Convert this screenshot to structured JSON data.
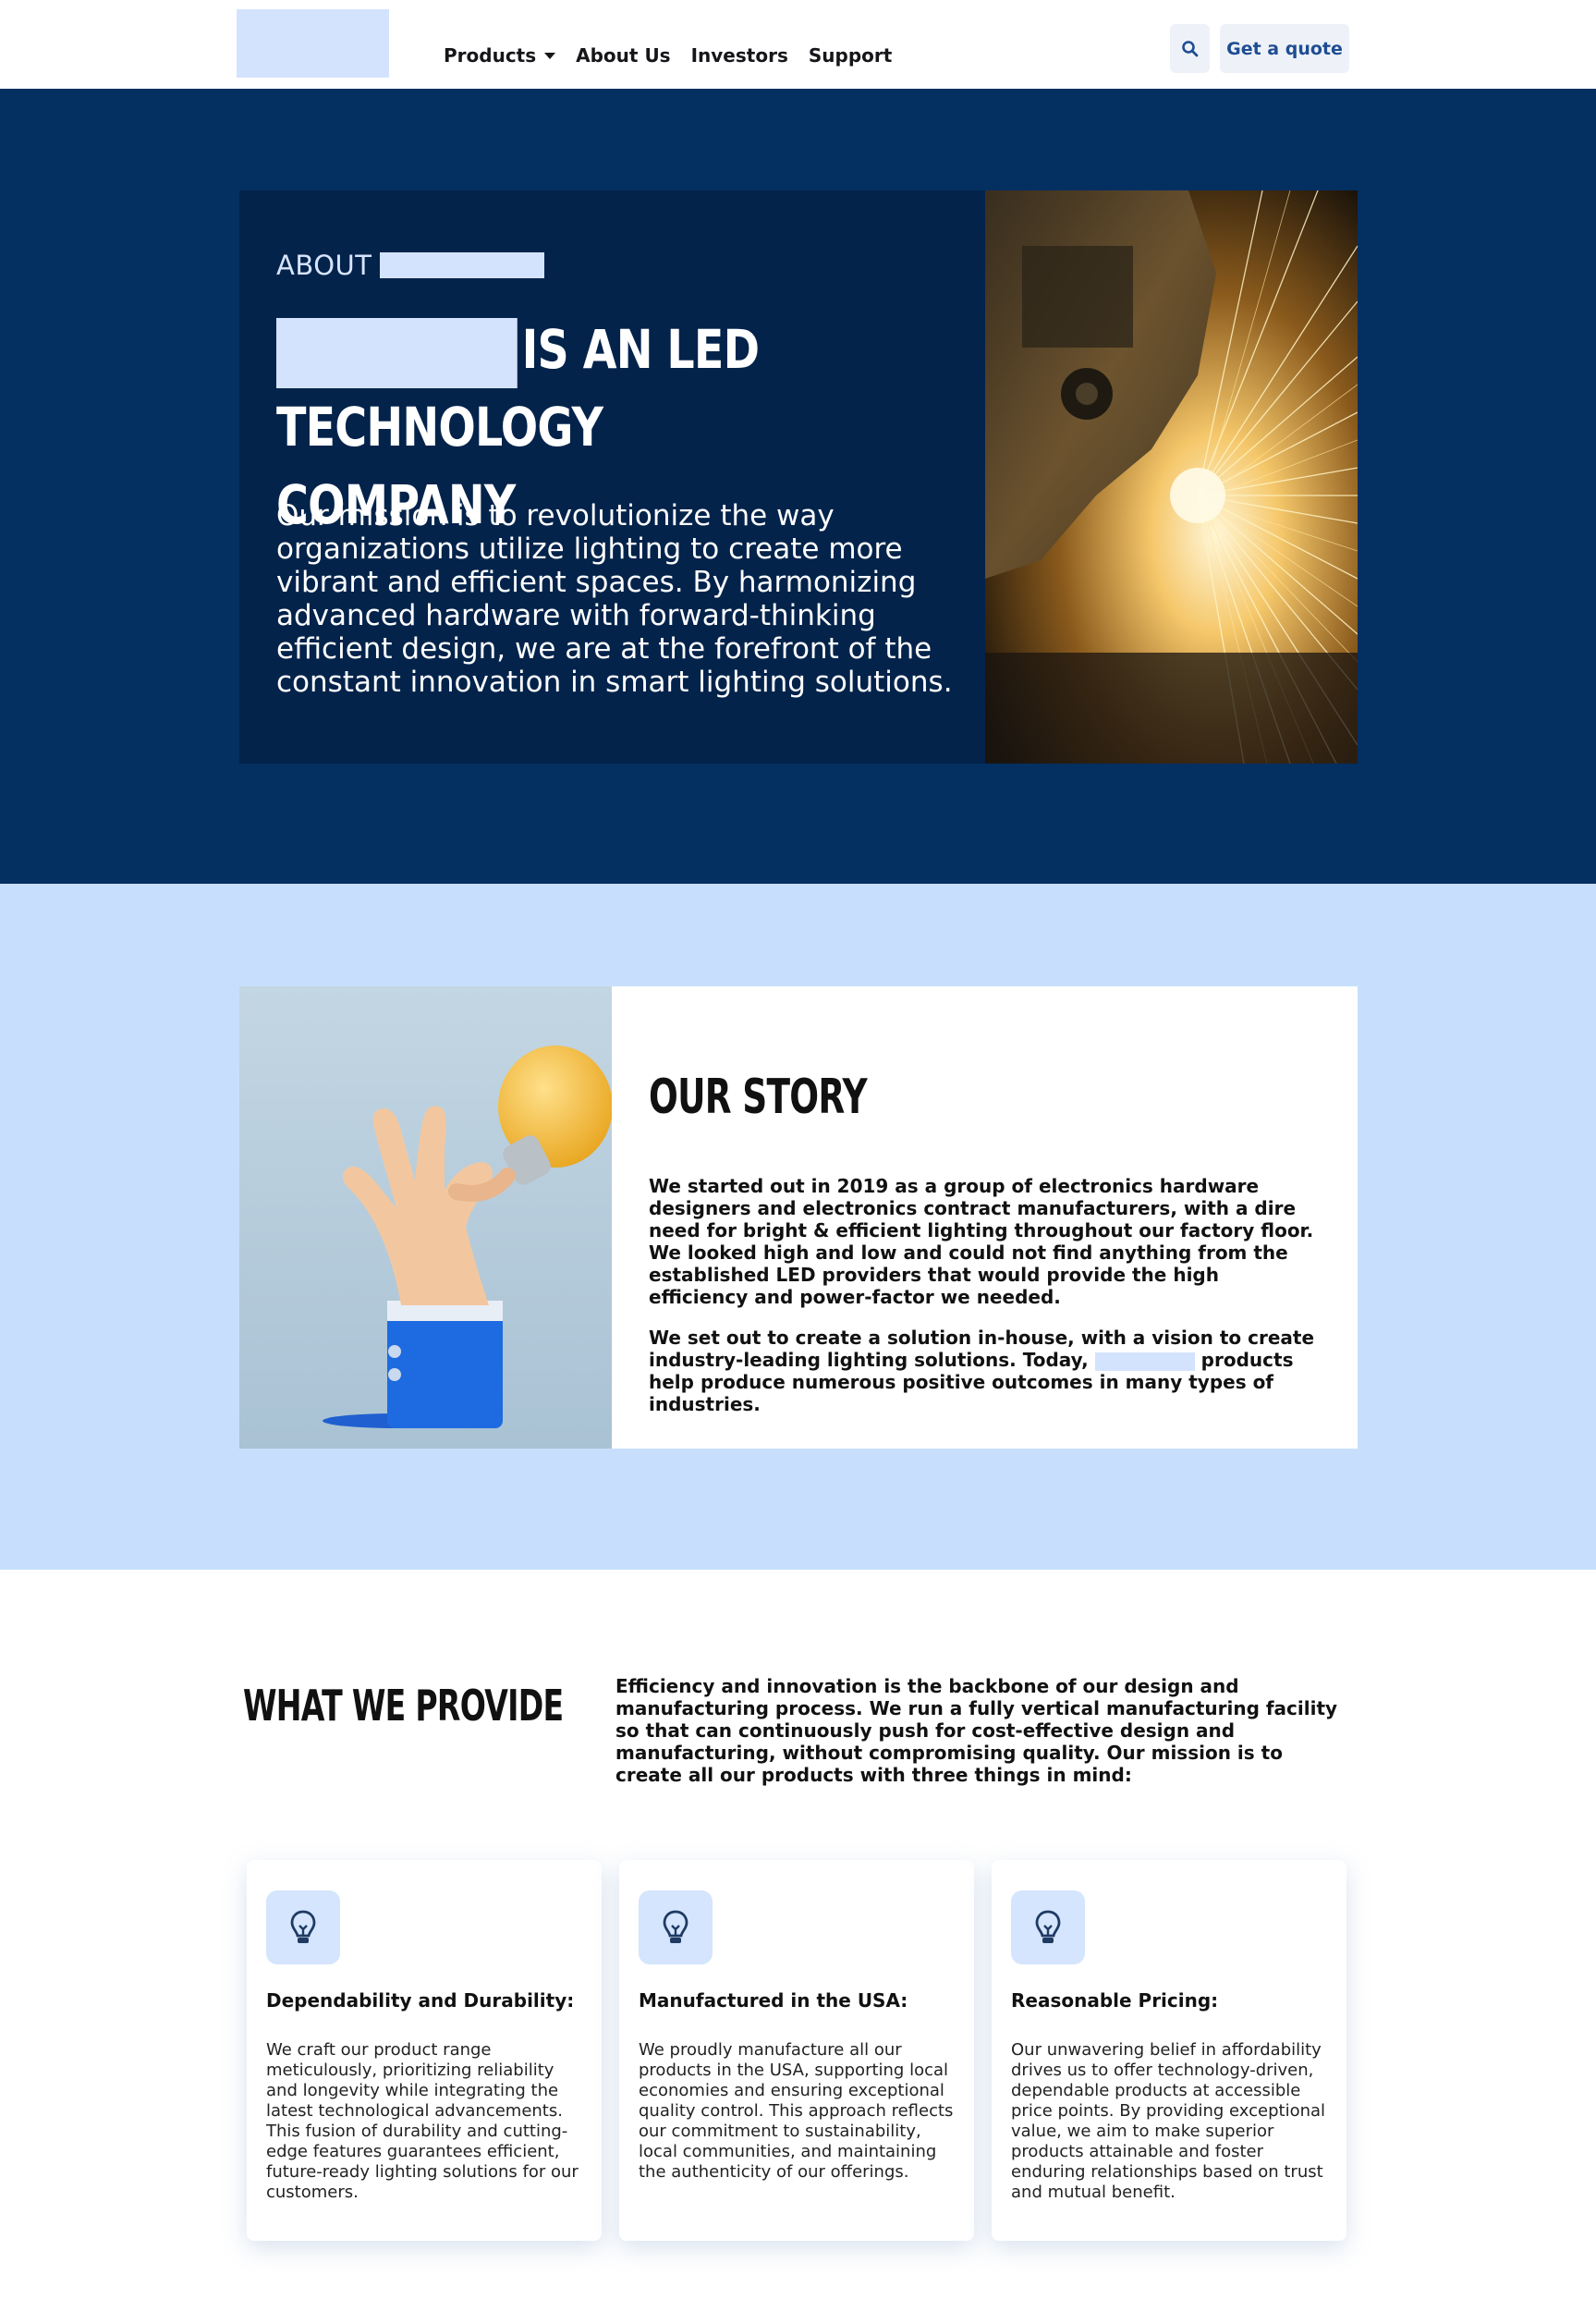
{
  "header": {
    "nav": [
      {
        "label": "Products",
        "has_dropdown": true
      },
      {
        "label": "About Us"
      },
      {
        "label": "Investors"
      },
      {
        "label": "Support"
      }
    ],
    "search_icon": "search-icon",
    "quote_button": "Get a quote"
  },
  "hero": {
    "eyebrow": "ABOUT",
    "title_line1": "IS AN LED",
    "title_line2": "TECHNOLOGY COMPANY",
    "mission": "Our mission is to revolutionize the way organizations utilize lighting to create more vibrant and efficient spaces. By harmonizing advanced hardware with forward-thinking efficient design, we are at the forefront of the constant innovation in smart lighting solutions."
  },
  "story": {
    "title": "OUR STORY",
    "paragraph1": "We started out in 2019 as a group of electronics hardware designers and electronics contract manufacturers, with a dire need for bright & efficient lighting throughout our factory floor. We looked high and low and could not find anything from the established LED providers that would provide the high efficiency and power-factor we needed.",
    "paragraph2_a": "We set out to create a solution in-house, with a vision to create industry-leading lighting solutions. Today,",
    "paragraph2_b": "products help produce numerous positive outcomes in many types of industries."
  },
  "provide": {
    "title": "WHAT WE PROVIDE",
    "intro": "Efficiency and innovation is the backbone of our design and manufacturing process. We run a fully vertical manufacturing facility so that can continuously push for cost-effective design and manufacturing, without compromising quality. Our mission is to create all our products with three things in mind:",
    "cards": [
      {
        "icon": "lightbulb-icon",
        "title": "Dependability and Durability:",
        "body": "We craft our product range meticulously, prioritizing reliability and longevity while integrating the latest technological advancements. This fusion of durability and cutting-edge features guarantees efficient, future-ready lighting solutions for our customers."
      },
      {
        "icon": "lightbulb-icon",
        "title": "Manufactured in the USA:",
        "body": "We proudly manufacture all our products in the USA, supporting local economies and ensuring exceptional quality control. This approach reflects our commitment to sustainability, local communities, and maintaining the authenticity of our offerings."
      },
      {
        "icon": "lightbulb-icon",
        "title": "Reasonable Pricing:",
        "body": "Our unwavering belief in affordability drives us to offer technology-driven, dependable products at accessible price points. By providing exceptional value, we aim to make superior products attainable and foster enduring relationships based on trust and mutual benefit."
      }
    ]
  },
  "colors": {
    "hero_bg": "#042f61",
    "hero_card": "#03234b",
    "story_bg": "#c7dffc",
    "placeholder": "#d4e3fd",
    "accent": "#1e4d92"
  }
}
